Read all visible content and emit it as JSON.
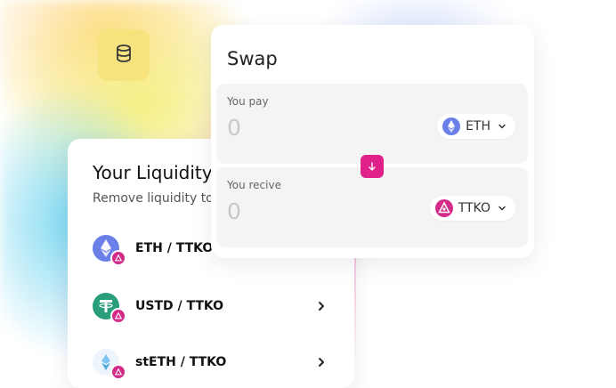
{
  "colors": {
    "accent": "#e0218a",
    "coin_tile": "#f6e37d",
    "eth": "#6b7fe8",
    "tether": "#2a9d7a",
    "steth": "#7fc4ef"
  },
  "coin_tile": {
    "icon": "coins-stack-icon"
  },
  "liquidity": {
    "title": "Your Liquidity",
    "subtitle": "Remove liquidity to re",
    "pairs": [
      {
        "label": "ETH / TTKO",
        "icon": "eth-icon",
        "badge": "ttko-icon"
      },
      {
        "label": "USTD / TTKO",
        "icon": "tether-icon",
        "badge": "ttko-icon"
      },
      {
        "label": "stETH / TTKO",
        "icon": "steth-icon",
        "badge": "ttko-icon"
      }
    ]
  },
  "swap": {
    "title": "Swap",
    "pay": {
      "label": "You pay",
      "value": "0",
      "token": "ETH",
      "icon": "eth-icon"
    },
    "receive": {
      "label": "You recive",
      "value": "0",
      "token": "TTKO",
      "icon": "ttko-icon"
    },
    "arrow_icon": "arrow-down-icon"
  }
}
